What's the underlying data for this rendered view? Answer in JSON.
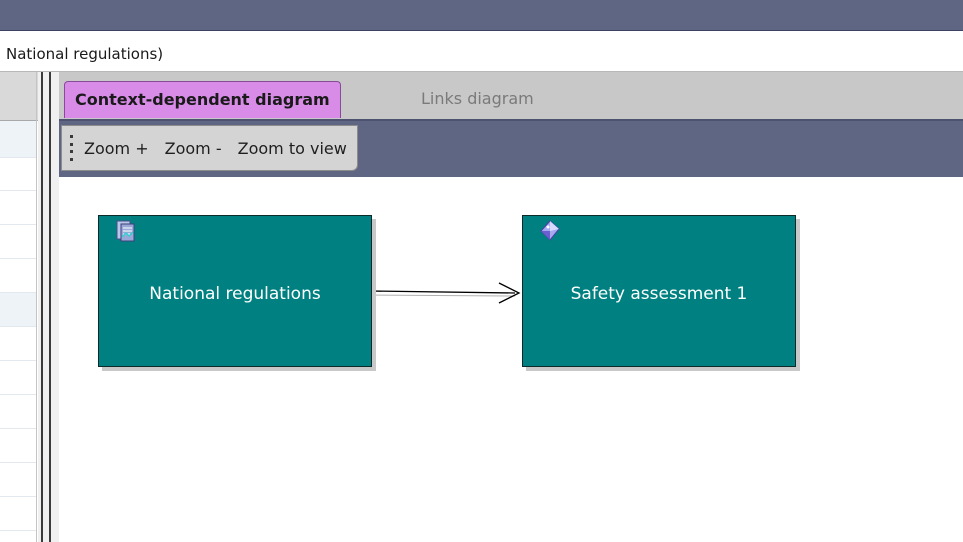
{
  "window": {
    "title": "National regulations)"
  },
  "tabs": [
    {
      "label": "Context-dependent diagram",
      "active": true
    },
    {
      "label": "Links diagram",
      "active": false
    }
  ],
  "toolbar": {
    "zoom_in_label": "Zoom +",
    "zoom_out_label": "Zoom -",
    "zoom_fit_label": "Zoom to view"
  },
  "diagram": {
    "nodes": [
      {
        "label": "National regulations",
        "icon": "regulation-document-icon"
      },
      {
        "label": "Safety assessment 1",
        "icon": "assessment-gem-icon"
      }
    ],
    "edges": [
      {
        "from": "National regulations",
        "to": "Safety assessment 1",
        "style": "arrow"
      }
    ]
  },
  "colors": {
    "accent_band": "#5f6684",
    "active_tab": "#d88ce8",
    "node_fill": "#008080",
    "node_text": "#ffffff"
  }
}
